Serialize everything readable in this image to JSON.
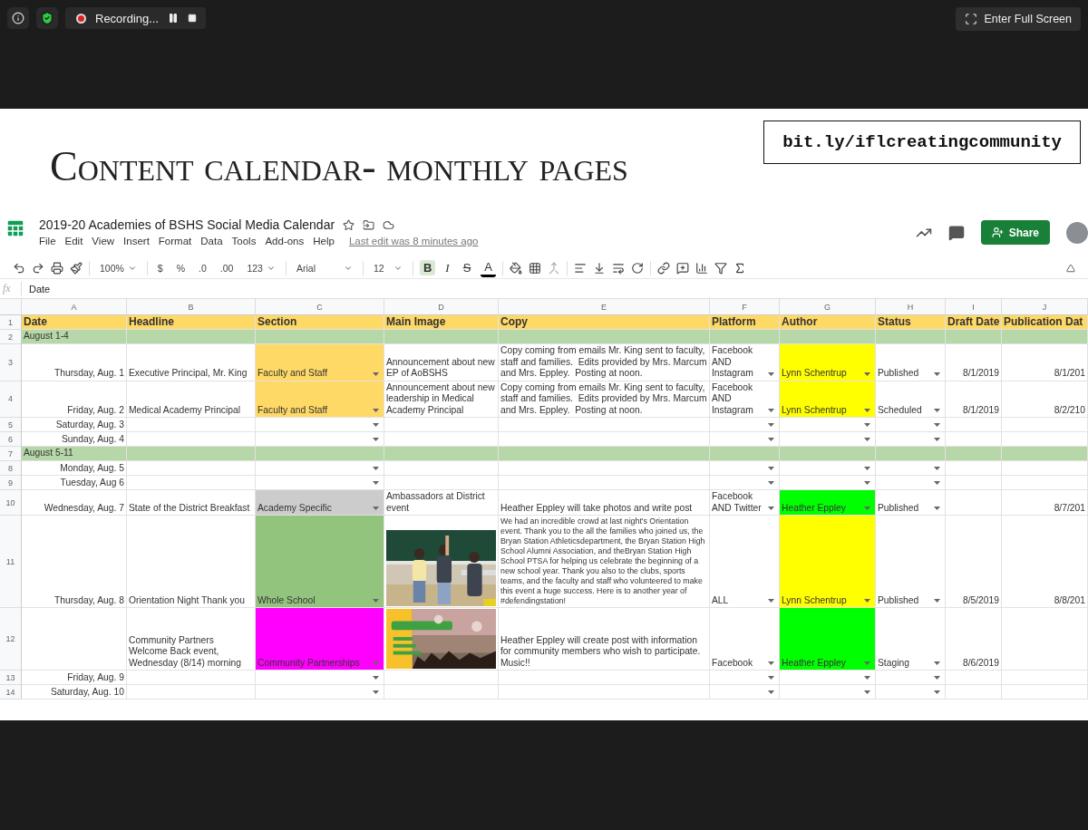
{
  "screen_share": {
    "status": "Recording...",
    "fullscreen_button": "Enter Full Screen"
  },
  "slide": {
    "title": "Content calendar- monthly pages",
    "link": "bit.ly/iflcreatingcommunity"
  },
  "spreadsheet": {
    "title": "2019-20 Academies of BSHS Social Media Calendar",
    "menu": [
      "File",
      "Edit",
      "View",
      "Insert",
      "Format",
      "Data",
      "Tools",
      "Add-ons",
      "Help"
    ],
    "last_edit": "Last edit was 8 minutes ago",
    "share_button": "Share",
    "toolbar": {
      "zoom": "100%",
      "currency": "$",
      "percent": "%",
      "decrease_decimals": ".0",
      "increase_decimals": ".00",
      "number_format": "123",
      "font": "Arial",
      "font_size": "12",
      "bold": {
        "label": "B",
        "selected": true
      },
      "italic": "I",
      "strikethrough": "S",
      "text_color": "A"
    },
    "formula_bar": {
      "label": "fx",
      "value": "Date"
    },
    "columns": [
      "A",
      "B",
      "C",
      "D",
      "E",
      "F",
      "G",
      "H",
      "I",
      "J"
    ],
    "rows": [
      {
        "number": "1",
        "kind": "header",
        "cells": [
          "Date",
          "Headline",
          "Section",
          "Main Image",
          "Copy",
          "Platform",
          "Author",
          "Status",
          "Draft Date",
          "Publication Dat"
        ]
      },
      {
        "number": "2",
        "kind": "group",
        "label": "August 1-4"
      },
      {
        "number": "3",
        "kind": "entry",
        "cells": [
          {
            "text": "Thursday, Aug. 1"
          },
          {
            "text": "Executive Principal, Mr. King"
          },
          {
            "text": "Faculty and Staff",
            "color": "#ffd966"
          },
          {
            "text": "Announcement about new EP of AoBSHS"
          },
          {
            "text": "Copy coming from emails Mr. King sent to faculty, staff and families.  Edits provided by Mrs. Marcum and Mrs. Eppley.  Posting at noon."
          },
          {
            "text": "Facebook AND Instagram"
          },
          {
            "text": "Lynn Schentrup",
            "color": "#ffff00"
          },
          {
            "text": "Published"
          },
          {
            "text": "8/1/2019"
          },
          {
            "text": "8/1/201"
          }
        ]
      },
      {
        "number": "4",
        "kind": "entry",
        "cells": [
          {
            "text": "Friday, Aug. 2"
          },
          {
            "text": "Medical Academy Principal"
          },
          {
            "text": "Faculty and Staff",
            "color": "#ffd966"
          },
          {
            "text": "Announcement about new leadership in Medical Academy Principal"
          },
          {
            "text": "Copy coming from emails Mr. King sent to faculty, staff and families.  Edits provided by Mrs. Marcum and Mrs. Eppley.  Posting at noon."
          },
          {
            "text": "Facebook AND Instagram"
          },
          {
            "text": "Lynn Schentrup",
            "color": "#ffff00"
          },
          {
            "text": "Scheduled"
          },
          {
            "text": "8/1/2019"
          },
          {
            "text": "8/2/210"
          }
        ]
      },
      {
        "number": "5",
        "kind": "entry",
        "cells": [
          {
            "text": "Saturday, Aug. 3"
          },
          {},
          {},
          {},
          {},
          {},
          {},
          {},
          {},
          {}
        ]
      },
      {
        "number": "6",
        "kind": "entry",
        "cells": [
          {
            "text": "Sunday, Aug. 4"
          },
          {},
          {},
          {},
          {},
          {},
          {},
          {},
          {},
          {}
        ]
      },
      {
        "number": "7",
        "kind": "group",
        "label": "August 5-11"
      },
      {
        "number": "8",
        "kind": "entry",
        "cells": [
          {
            "text": "Monday, Aug. 5"
          },
          {},
          {},
          {},
          {},
          {},
          {},
          {},
          {},
          {}
        ]
      },
      {
        "number": "9",
        "kind": "entry",
        "cells": [
          {
            "text": "Tuesday, Aug 6"
          },
          {},
          {},
          {},
          {},
          {},
          {},
          {},
          {},
          {}
        ]
      },
      {
        "number": "10",
        "kind": "entry",
        "cells": [
          {
            "text": "Wednesday, Aug. 7"
          },
          {
            "text": "State of the District Breakfast"
          },
          {
            "text": "Academy Specific",
            "color": "#cccccc"
          },
          {
            "text": "Ambassadors at District event"
          },
          {
            "text": "Heather Eppley will take photos and write post"
          },
          {
            "text": "Facebook AND Twitter"
          },
          {
            "text": "Heather Eppley",
            "color": "#00ff00"
          },
          {
            "text": "Published"
          },
          {},
          {
            "text": "8/7/201"
          }
        ]
      },
      {
        "number": "11",
        "kind": "entry",
        "cells": [
          {
            "text": "Thursday, Aug. 8"
          },
          {
            "text": "Orientation Night Thank you"
          },
          {
            "text": "Whole School",
            "color": "#93c47d"
          },
          {
            "kind": "picture"
          },
          {
            "text": "We had an incredible crowd at last night's Orientation event. Thank you to the all the families who joined us, the Bryan Station Athleticsdepartment, the Bryan Station High School Alumni Association, and theBryan Station High School PTSA for helping us celebrate the beginning of a new school year. Thank you also to the clubs, sports teams, and the faculty and staff who volunteered to make this event a huge success. Here is to another year of #defendingstation!"
          },
          {
            "text": "ALL"
          },
          {
            "text": "Lynn Schentrup",
            "color": "#ffff00"
          },
          {
            "text": "Published"
          },
          {
            "text": "8/5/2019"
          },
          {
            "text": "8/8/201"
          }
        ]
      },
      {
        "number": "12",
        "kind": "entry",
        "cells": [
          {},
          {
            "text": "Community Partners Welcome Back event, Wednesday (8/14) morning"
          },
          {
            "text": "Community Partnerships",
            "color": "#ff00ff"
          },
          {
            "kind": "picture"
          },
          {
            "text": "Heather Eppley will create post with information for community members who wish to participate. Music!!"
          },
          {
            "text": "Facebook"
          },
          {
            "text": "Heather Eppley",
            "color": "#00ff00"
          },
          {
            "text": "Staging"
          },
          {
            "text": "8/6/2019"
          },
          {}
        ]
      },
      {
        "number": "13",
        "kind": "entry",
        "cells": [
          {
            "text": "Friday, Aug. 9"
          },
          {},
          {},
          {},
          {},
          {},
          {},
          {},
          {},
          {}
        ]
      },
      {
        "number": "14",
        "kind": "entry",
        "cells": [
          {
            "text": "Saturday, Aug. 10"
          },
          {},
          {},
          {},
          {},
          {},
          {},
          {},
          {},
          {}
        ]
      }
    ]
  }
}
